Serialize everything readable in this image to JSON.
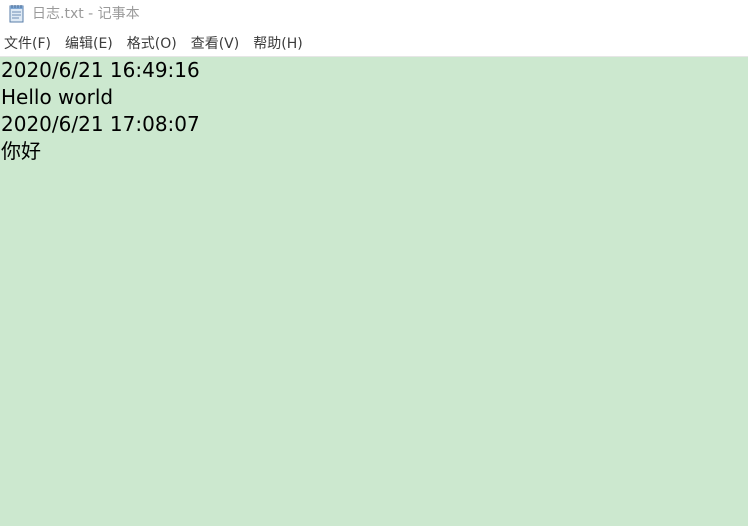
{
  "window": {
    "title": "日志.txt - 记事本",
    "app_icon": "notepad-icon"
  },
  "menu": {
    "items": [
      {
        "label": "文件(F)"
      },
      {
        "label": "编辑(E)"
      },
      {
        "label": "格式(O)"
      },
      {
        "label": "查看(V)"
      },
      {
        "label": "帮助(H)"
      }
    ]
  },
  "editor": {
    "background_color": "#cce8cf",
    "lines": [
      "2020/6/21 16:49:16",
      "Hello world",
      "2020/6/21 17:08:07",
      "你好"
    ]
  }
}
